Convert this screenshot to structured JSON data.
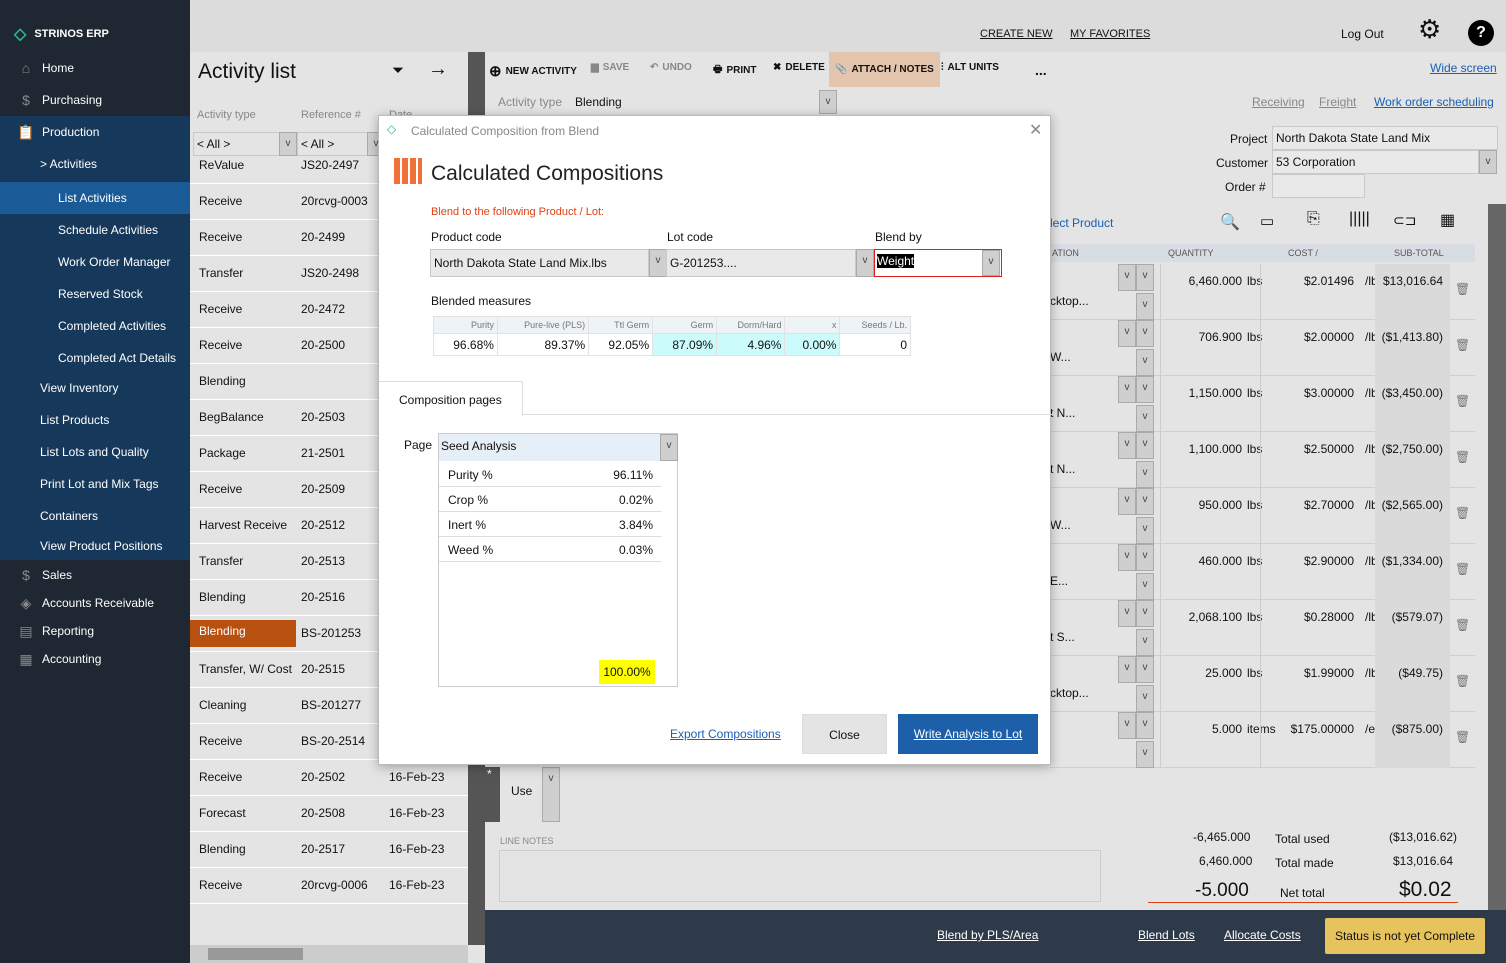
{
  "app": {
    "brand": "STRINOS ERP"
  },
  "sidebar": {
    "items": [
      {
        "label": "Home",
        "icon": "home-icon",
        "level": 0
      },
      {
        "label": "Purchasing",
        "icon": "dollar-icon",
        "level": 0
      },
      {
        "label": "Production",
        "icon": "clipboard-icon",
        "level": 0
      },
      {
        "label": "> Activities",
        "level": 1
      },
      {
        "label": "List Activities",
        "level": 2,
        "selected": true
      },
      {
        "label": "Schedule Activities",
        "level": 2
      },
      {
        "label": "Work Order Manager",
        "level": 2
      },
      {
        "label": "Reserved Stock",
        "level": 2
      },
      {
        "label": "Completed Activities",
        "level": 2
      },
      {
        "label": "Completed Act Details",
        "level": 2
      },
      {
        "label": "View Inventory",
        "level": 1
      },
      {
        "label": "List Products",
        "level": 1
      },
      {
        "label": "List Lots and Quality",
        "level": 1
      },
      {
        "label": "Print Lot and Mix Tags",
        "level": 1
      },
      {
        "label": "Containers",
        "level": 1
      },
      {
        "label": "View Product Positions",
        "level": 1
      },
      {
        "label": "Sales",
        "icon": "dollar-icon",
        "level": 0
      },
      {
        "label": "Accounts Receivable",
        "icon": "receivable-icon",
        "level": 0
      },
      {
        "label": "Reporting",
        "icon": "report-icon",
        "level": 0
      },
      {
        "label": "Accounting",
        "icon": "calculator-icon",
        "level": 0
      }
    ]
  },
  "topbar": {
    "create_new": "CREATE NEW",
    "my_favorites": "MY FAVORITES",
    "log_out": "Log Out"
  },
  "activity_list": {
    "title": "Activity list",
    "col_type": "Activity type",
    "col_ref": "Reference #",
    "col_date": "Date",
    "filter_type": "< All >",
    "filter_ref": "< All >",
    "rows": [
      {
        "type": "ReValue",
        "ref": "JS20-2497",
        "date": ""
      },
      {
        "type": "Receive",
        "ref": "20rcvg-0003",
        "date": ""
      },
      {
        "type": "Receive",
        "ref": "20-2499",
        "date": ""
      },
      {
        "type": "Transfer",
        "ref": "JS20-2498",
        "date": ""
      },
      {
        "type": "Receive",
        "ref": "20-2472",
        "date": ""
      },
      {
        "type": "Receive",
        "ref": "20-2500",
        "date": ""
      },
      {
        "type": "Blending",
        "ref": "",
        "date": ""
      },
      {
        "type": "BegBalance",
        "ref": "20-2503",
        "date": ""
      },
      {
        "type": "Package",
        "ref": "21-2501",
        "date": ""
      },
      {
        "type": "Receive",
        "ref": "20-2509",
        "date": ""
      },
      {
        "type": "Harvest Receive",
        "ref": "20-2512",
        "date": ""
      },
      {
        "type": "Transfer",
        "ref": "20-2513",
        "date": ""
      },
      {
        "type": "Blending",
        "ref": "20-2516",
        "date": ""
      },
      {
        "type": "Blending",
        "ref": "BS-201253",
        "date": "",
        "selected": true
      },
      {
        "type": "Transfer, W/ Cost",
        "ref": "20-2515",
        "date": ""
      },
      {
        "type": "Cleaning",
        "ref": "BS-201277",
        "date": ""
      },
      {
        "type": "Receive",
        "ref": "BS-20-2514",
        "date": ""
      },
      {
        "type": "Receive",
        "ref": "20-2502",
        "date": "16-Feb-23"
      },
      {
        "type": "Forecast",
        "ref": "20-2508",
        "date": "16-Feb-23"
      },
      {
        "type": "Blending",
        "ref": "20-2517",
        "date": "16-Feb-23"
      },
      {
        "type": "Receive",
        "ref": "20rcvg-0006",
        "date": "16-Feb-23"
      }
    ]
  },
  "toolbar": {
    "new_activity": "NEW ACTIVITY",
    "save": "SAVE",
    "undo": "UNDO",
    "print": "PRINT",
    "delete": "DELETE",
    "attach": "ATTACH / NOTES",
    "alt_units": "ALT UNITS",
    "more": "...",
    "wide_screen": "Wide screen"
  },
  "form": {
    "activity_type_label": "Activity type",
    "activity_type": "Blending",
    "receiving": "Receiving",
    "freight": "Freight",
    "work_order": "Work order scheduling",
    "project_label": "Project",
    "project": "North Dakota State Land Mix",
    "customer_label": "Customer",
    "customer": "53 Corporation",
    "order_label": "Order #",
    "order": "",
    "select_product": "lect Product"
  },
  "grid": {
    "headers": {
      "location": "ATION",
      "quantity": "QUANTITY",
      "cost": "COST  /",
      "subtotal": "SUB-TOTAL"
    },
    "rows": [
      {
        "desc": "cktop...",
        "qty": "6,460.000",
        "unit": "lbs",
        "cost": "$2.01496",
        "per": "/lb",
        "sub": "$13,016.64"
      },
      {
        "desc": "W...",
        "qty": "706.900",
        "unit": "lbs",
        "cost": "$2.00000",
        "per": "/lb",
        "sub": "($1,413.80)"
      },
      {
        "desc": "t N...",
        "qty": "1,150.000",
        "unit": "lbs",
        "cost": "$3.00000",
        "per": "/lb",
        "sub": "($3,450.00)"
      },
      {
        "desc": "t N...",
        "qty": "1,100.000",
        "unit": "lbs",
        "cost": "$2.50000",
        "per": "/lb",
        "sub": "($2,750.00)"
      },
      {
        "desc": "W...",
        "qty": "950.000",
        "unit": "lbs",
        "cost": "$2.70000",
        "per": "/lb",
        "sub": "($2,565.00)"
      },
      {
        "desc": "E...",
        "qty": "460.000",
        "unit": "lbs",
        "cost": "$2.90000",
        "per": "/lb",
        "sub": "($1,334.00)"
      },
      {
        "desc": "t S...",
        "qty": "2,068.100",
        "unit": "lbs",
        "cost": "$0.28000",
        "per": "/lb",
        "sub": "($579.07)"
      },
      {
        "desc": "cktop...",
        "qty": "25.000",
        "unit": "lbs",
        "cost": "$1.99000",
        "per": "/lb",
        "sub": "($49.75)"
      },
      {
        "desc": "",
        "qty": "5.000",
        "unit": "items",
        "cost": "$175.00000",
        "per": "/ea",
        "sub": "($875.00)"
      }
    ],
    "new_row_use": "Use"
  },
  "totals": {
    "line_notes": "LINE NOTES",
    "used_qty": "-6,465.000",
    "used_label": "Total used",
    "used_amt": "($13,016.62)",
    "made_qty": "6,460.000",
    "made_label": "Total made",
    "made_amt": "$13,016.64",
    "net_qty": "-5.000",
    "net_label": "Net total",
    "net_amt": "$0.02"
  },
  "bottom": {
    "blend_pls": "Blend by PLS/Area",
    "blend_lots": "Blend Lots",
    "allocate": "Allocate Costs",
    "status": "Status is not yet Complete"
  },
  "modal": {
    "window_title": "Calculated Composition from Blend",
    "heading": "Calculated Compositions",
    "blend_to": "Blend to the following Product / Lot:",
    "product_label": "Product code",
    "product": "North Dakota State Land Mix.lbs",
    "lot_label": "Lot code",
    "lot": "G-201253....",
    "blend_by_label": "Blend by",
    "blend_by": "Weight",
    "measures_label": "Blended measures",
    "measures": [
      {
        "h": "Purity",
        "v": "96.68%"
      },
      {
        "h": "Pure-live (PLS)",
        "v": "89.37%"
      },
      {
        "h": "Ttl Germ",
        "v": "92.05%"
      },
      {
        "h": "Germ",
        "v": "87.09%",
        "hl": true
      },
      {
        "h": "Dorm/Hard",
        "v": "4.96%",
        "hl": true
      },
      {
        "h": "x",
        "v": "0.00%",
        "hl": true
      },
      {
        "h": "Seeds / Lb.",
        "v": "0"
      }
    ],
    "tab": "Composition pages",
    "page_label": "Page",
    "page": "Seed Analysis",
    "page_rows": [
      {
        "k": "Purity %",
        "v": "96.11%"
      },
      {
        "k": "Crop %",
        "v": "0.02%"
      },
      {
        "k": "Inert %",
        "v": "3.84%"
      },
      {
        "k": "Weed %",
        "v": "0.03%"
      }
    ],
    "page_total": "100.00%",
    "export": "Export Compositions",
    "close": "Close",
    "write": "Write Analysis to Lot"
  },
  "colors": {
    "accent": "#e8733a",
    "sidebar": "#1f2732",
    "selected_nav": "#1a5a96",
    "selected_row": "#b8500f",
    "status": "#e6c35c",
    "link": "#1a5fb4"
  }
}
